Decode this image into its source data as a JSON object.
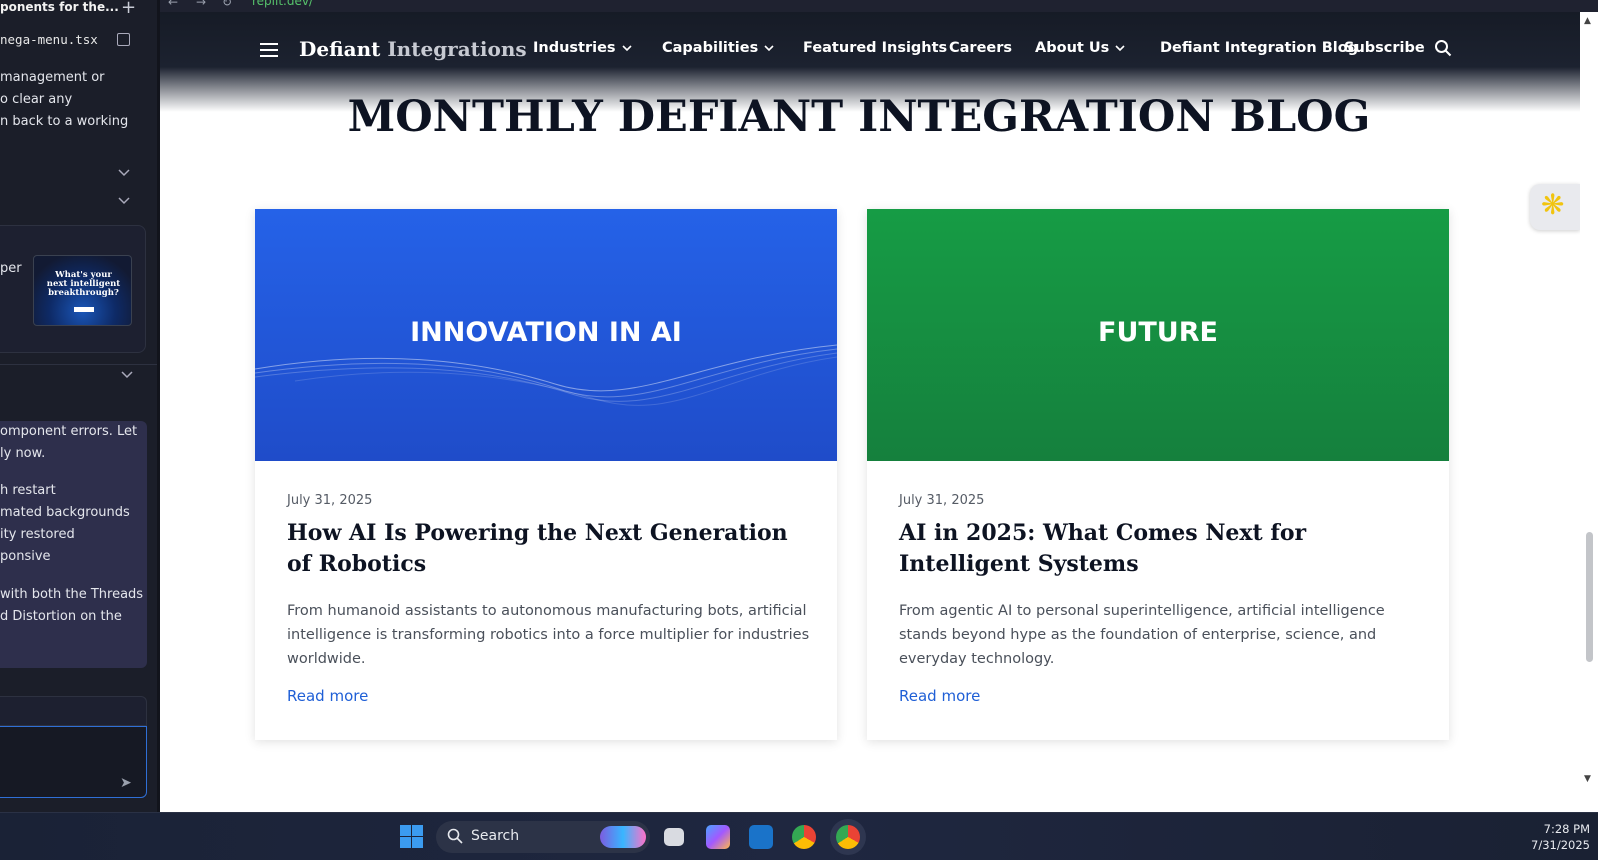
{
  "left_panel": {
    "top_text": "ponents for the...",
    "file_tab": "nega-menu.tsx",
    "msg1_lines": [
      "management or",
      "o clear any",
      "n back to a working"
    ],
    "thumb_text_lines": [
      "What's your",
      "next intelligent",
      "breakthrough?"
    ],
    "thumb_left_text": "per",
    "msg2_lines": [
      "omponent errors. Let",
      "ly now."
    ],
    "msg2_list": [
      "h restart",
      "mated backgrounds",
      "ity restored",
      "ponsive"
    ],
    "msg2_tail": [
      "with both the Threads",
      "d Distortion on the"
    ]
  },
  "browser": {
    "url": "replit.dev/"
  },
  "site": {
    "brand_bold": "Defiant",
    "brand_light": "Integrations",
    "nav": [
      {
        "label": "Industries",
        "dropdown": true
      },
      {
        "label": "Capabilities",
        "dropdown": true
      },
      {
        "label": "Featured Insights",
        "dropdown": false
      },
      {
        "label": "Careers",
        "dropdown": false
      },
      {
        "label": "About Us",
        "dropdown": true
      },
      {
        "label": "Defiant Integration Blog",
        "dropdown": false
      },
      {
        "label": "Subscribe",
        "dropdown": false
      }
    ],
    "page_title": "MONTHLY DEFIANT INTEGRATION BLOG",
    "posts": [
      {
        "tag": "INNOVATION IN AI",
        "date": "July 31, 2025",
        "title": "How AI Is Powering the Next Generation of Robotics",
        "excerpt": "From humanoid assistants to autonomous manufacturing bots, artificial intelligence is transforming robotics into a force multiplier for industries worldwide.",
        "link": "Read more",
        "color": "#2563eb"
      },
      {
        "tag": "FUTURE",
        "date": "July 31, 2025",
        "title": "AI in 2025: What Comes Next for Intelligent Systems",
        "excerpt": "From agentic AI to personal superintelligence, artificial intelligence stands beyond hype as the foundation of enterprise, science, and everyday technology.",
        "link": "Read more",
        "color": "#16a34a"
      }
    ]
  },
  "taskbar": {
    "search_label": "Search",
    "time": "7:28 PM",
    "date": "7/31/2025"
  }
}
